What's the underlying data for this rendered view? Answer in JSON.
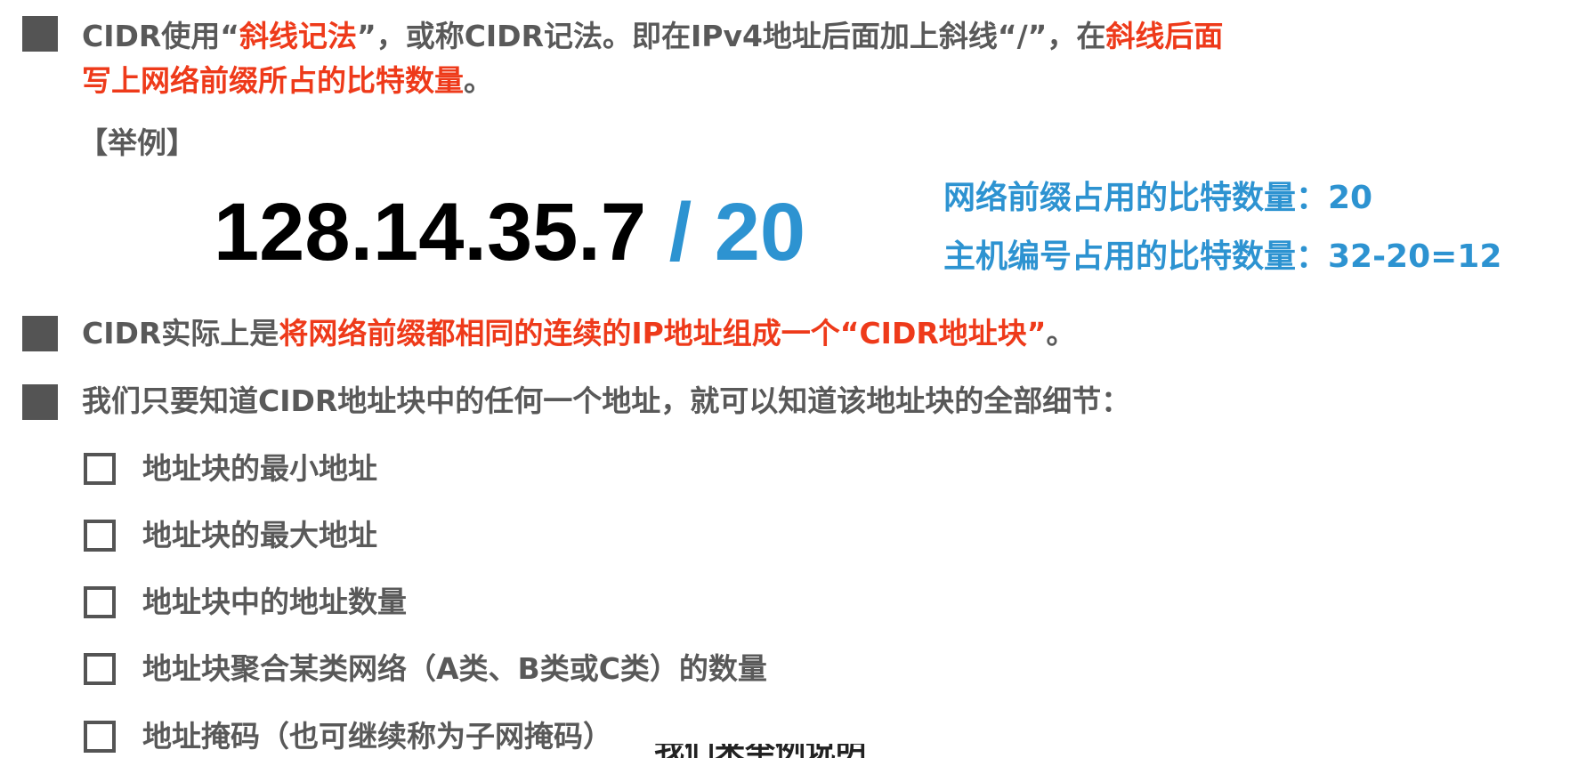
{
  "p1": {
    "a": "CIDR使用“",
    "b": "斜线记法",
    "c": "”，或称CIDR记法。即在IPv4地址后面加上斜线“/”，在",
    "d": "斜线后面",
    "e": "写上网络前缀所占的比特数量",
    "f": "。"
  },
  "example": {
    "label": "【举例】",
    "ip": "128.14.35.7",
    "sep": " / ",
    "prefix": "20",
    "note1": "网络前缀占用的比特数量：20",
    "note2": "主机编号占用的比特数量：32-20=12"
  },
  "p2": {
    "a": "CIDR实际上是",
    "b": "将网络前缀都相同的连续的IP地址组成一个“CIDR地址块”",
    "c": "。"
  },
  "p3": {
    "text": "我们只要知道CIDR地址块中的任何一个地址，就可以知道该地址块的全部细节："
  },
  "items": [
    "地址块的最小地址",
    "地址块的最大地址",
    "地址块中的地址数量",
    "地址块聚合某类网络（A类、B类或C类）的数量",
    "地址掩码（也可继续称为子网掩码）"
  ],
  "subtitle": "我们来举例说明"
}
